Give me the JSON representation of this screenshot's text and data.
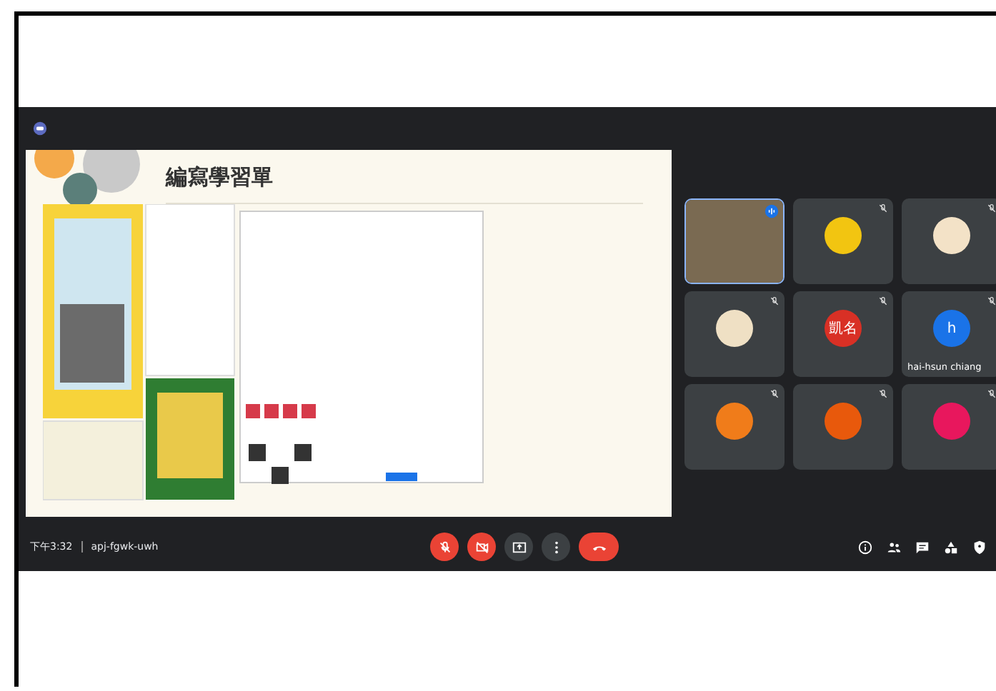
{
  "slide": {
    "title": "編寫學習單"
  },
  "participants": [
    {
      "kind": "video",
      "speaking": true
    },
    {
      "kind": "avatar",
      "color": "#f2c511",
      "speaking": false
    },
    {
      "kind": "avatar",
      "color": "#f3e2c7",
      "speaking": false
    },
    {
      "kind": "avatar",
      "color": "#efe0c4",
      "speaking": false
    },
    {
      "kind": "avatar",
      "color": "#d93025",
      "avatar_text": "凱名",
      "speaking": false
    },
    {
      "kind": "avatar",
      "color": "#1a73e8",
      "avatar_text": "h",
      "name": "hai-hsun chiang",
      "speaking": false
    },
    {
      "kind": "avatar",
      "color": "#f07c1a",
      "speaking": false
    },
    {
      "kind": "avatar",
      "color": "#e8590c",
      "speaking": false
    },
    {
      "kind": "avatar",
      "color": "#e8175d",
      "speaking": false
    }
  ],
  "status_bar": {
    "time": "下午3:32",
    "meeting_code": "apj-fgwk-uwh"
  },
  "controls": [
    {
      "kind": "mic-off"
    },
    {
      "kind": "cam-off"
    },
    {
      "kind": "present"
    },
    {
      "kind": "more"
    },
    {
      "kind": "hangup"
    }
  ],
  "side_icons": [
    {
      "kind": "info"
    },
    {
      "kind": "people"
    },
    {
      "kind": "chat"
    },
    {
      "kind": "activities"
    },
    {
      "kind": "shield"
    }
  ]
}
